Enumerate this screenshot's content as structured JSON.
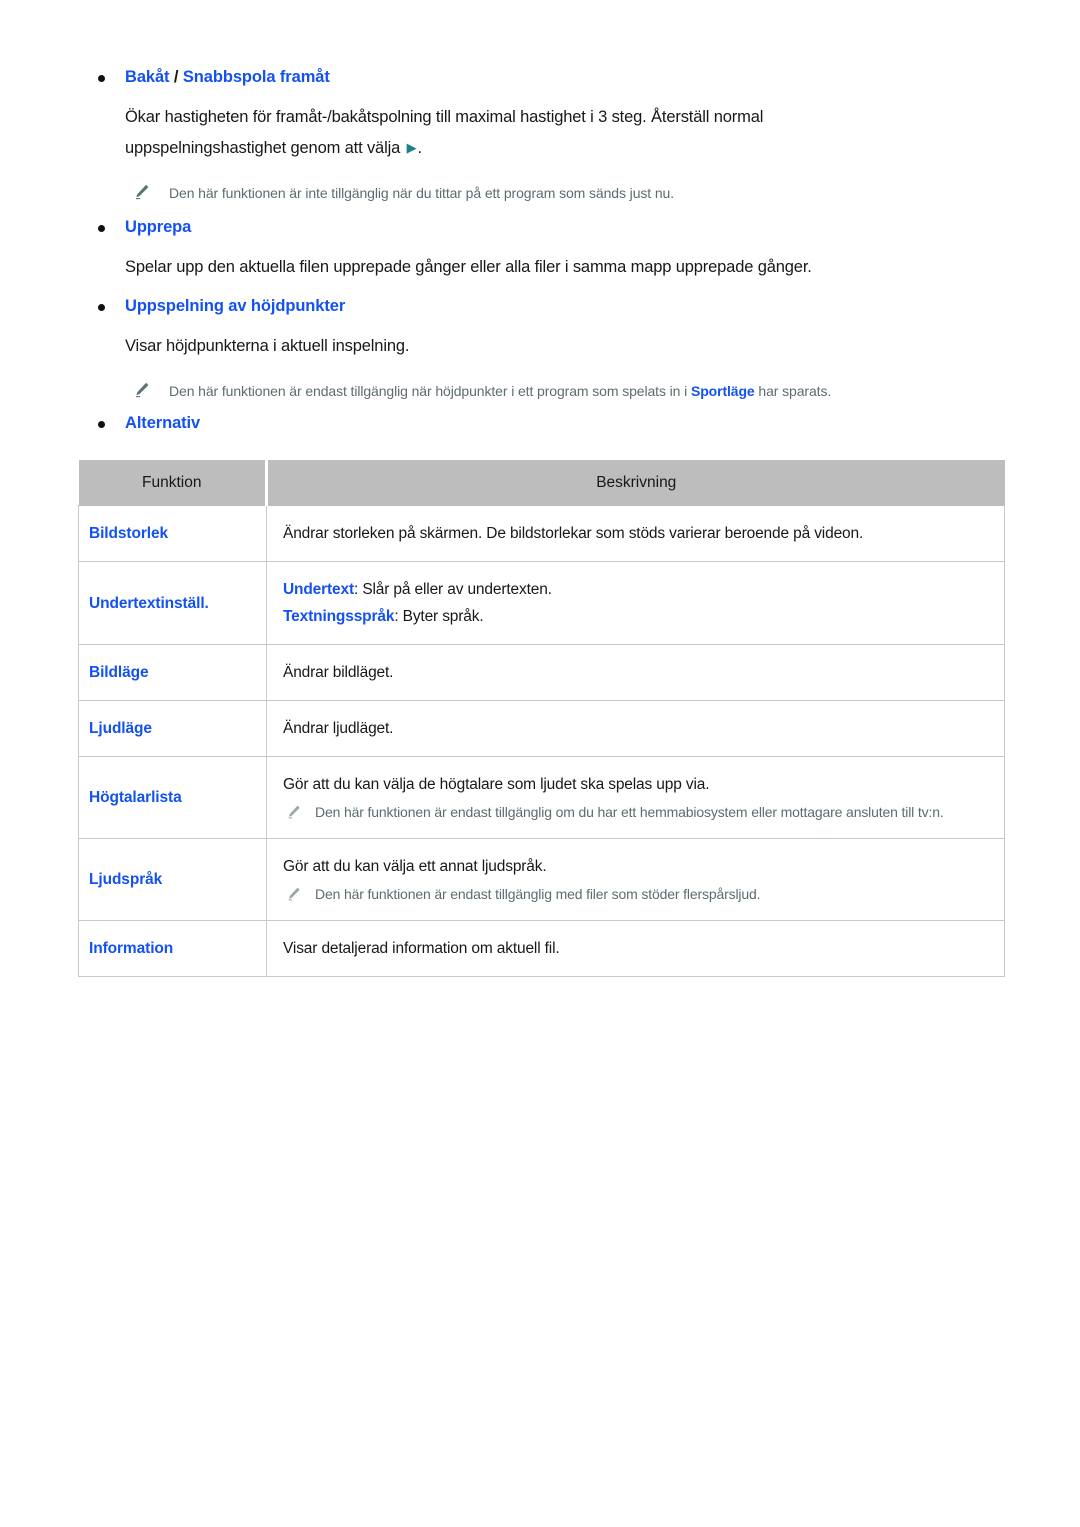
{
  "page": {
    "language": "sv",
    "colors": {
      "link_blue": "#1452f0",
      "body_text": "#16181a",
      "note_gray": "#5d6c70",
      "table_header_bg": "#bdbdbd",
      "table_border": "#c9c9c9",
      "play_icon_teal": "#1f7f87"
    }
  },
  "sections": [
    {
      "heading": {
        "part1": "Bakåt",
        "separator": " / ",
        "part2": "Snabbspola framåt"
      },
      "body_before_icon": "Ökar hastigheten för framåt-/bakåtspolning till maximal hastighet i 3 steg. Återställ normal uppspelningshastighet genom att välja ",
      "play_icon": "play-icon",
      "body_after_icon": ".",
      "note": "Den här funktionen är inte tillgänglig när du tittar på ett program som sänds just nu."
    },
    {
      "heading": {
        "part1": "Upprepa",
        "separator": "",
        "part2": ""
      },
      "body": "Spelar upp den aktuella filen upprepade gånger eller alla filer i samma mapp upprepade gånger."
    },
    {
      "heading": {
        "part1": "Uppspelning av höjdpunkter",
        "separator": "",
        "part2": ""
      },
      "body": "Visar höjdpunkterna i aktuell inspelning.",
      "note_parts": {
        "before": "Den här funktionen är endast tillgänglig när höjdpunkter i ett program som spelats in i ",
        "highlight": "Sportläge",
        "after": " har sparats."
      }
    },
    {
      "heading": {
        "part1": "Alternativ",
        "separator": "",
        "part2": ""
      }
    }
  ],
  "table": {
    "columns": [
      "Funktion",
      "Beskrivning"
    ],
    "rows": [
      {
        "function": "Bildstorlek",
        "lines": [
          {
            "type": "text",
            "text": "Ändrar storleken på skärmen. De bildstorlekar som stöds varierar beroende på videon."
          }
        ]
      },
      {
        "function": "Undertextinställ.",
        "lines": [
          {
            "type": "labeled",
            "label": "Undertext",
            "text": ": Slår på eller av undertexten."
          },
          {
            "type": "labeled",
            "label": "Textningsspråk",
            "text": ": Byter språk."
          }
        ]
      },
      {
        "function": "Bildläge",
        "lines": [
          {
            "type": "text",
            "text": "Ändrar bildläget."
          }
        ]
      },
      {
        "function": "Ljudläge",
        "lines": [
          {
            "type": "text",
            "text": "Ändrar ljudläget."
          }
        ]
      },
      {
        "function": "Högtalarlista",
        "lines": [
          {
            "type": "text",
            "text": "Gör att du kan välja de högtalare som ljudet ska spelas upp via."
          },
          {
            "type": "note",
            "text": "Den här funktionen är endast tillgänglig om du har ett hemmabiosystem eller mottagare ansluten till tv:n."
          }
        ]
      },
      {
        "function": "Ljudspråk",
        "lines": [
          {
            "type": "text",
            "text": "Gör att du kan välja ett annat ljudspråk."
          },
          {
            "type": "note",
            "text": "Den här funktionen är endast tillgänglig med filer som stöder flerspårsljud."
          }
        ]
      },
      {
        "function": "Information",
        "lines": [
          {
            "type": "text",
            "text": "Visar detaljerad information om aktuell fil."
          }
        ]
      }
    ]
  }
}
